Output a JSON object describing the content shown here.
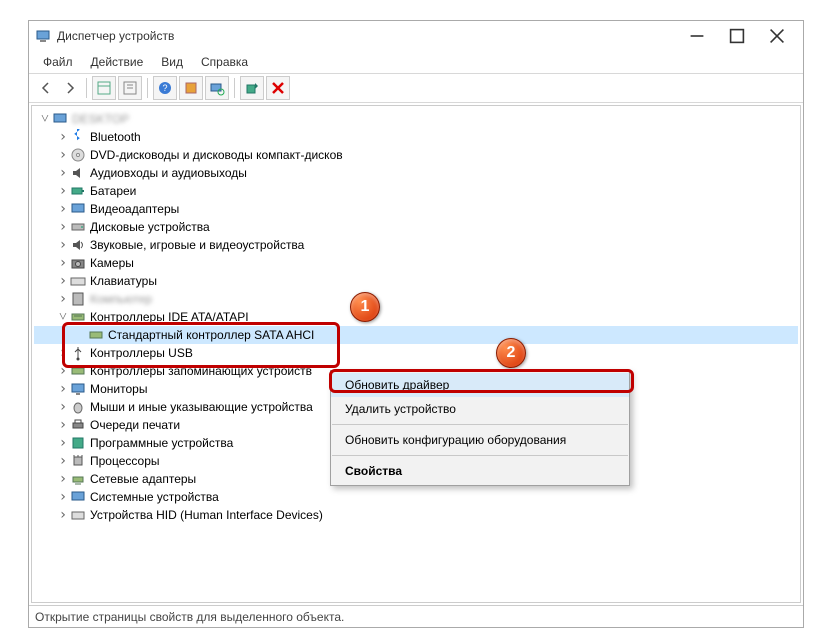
{
  "window": {
    "title": "Диспетчер устройств"
  },
  "menu": {
    "file": "Файл",
    "action": "Действие",
    "view": "Вид",
    "help": "Справка"
  },
  "tree": {
    "root": "DESKTOP",
    "bluetooth": "Bluetooth",
    "dvd": "DVD-дисководы и дисководы компакт-дисков",
    "audio": "Аудиовходы и аудиовыходы",
    "battery": "Батареи",
    "video": "Видеоадаптеры",
    "disk": "Дисковые устройства",
    "sound": "Звуковые, игровые и видеоустройства",
    "camera": "Камеры",
    "keyboard": "Клавиатуры",
    "computer": "Компьютер",
    "ide": "Контроллеры IDE ATA/ATAPI",
    "sata": "Стандартный контроллер SATA AHCI",
    "usb_ctrl": "Контроллеры USB",
    "storage_ctrl": "Контроллеры запоминающих устройств",
    "monitor": "Мониторы",
    "mouse": "Мыши и иные указывающие устройства",
    "printq": "Очереди печати",
    "software": "Программные устройства",
    "cpu": "Процессоры",
    "net": "Сетевые адаптеры",
    "system": "Системные устройства",
    "hid": "Устройства HID (Human Interface Devices)"
  },
  "context_menu": {
    "update_driver": "Обновить драйвер",
    "remove": "Удалить устройство",
    "refresh_hw": "Обновить конфигурацию оборудования",
    "properties": "Свойства"
  },
  "callouts": {
    "one": "1",
    "two": "2"
  },
  "status": "Открытие страницы свойств для выделенного объекта."
}
